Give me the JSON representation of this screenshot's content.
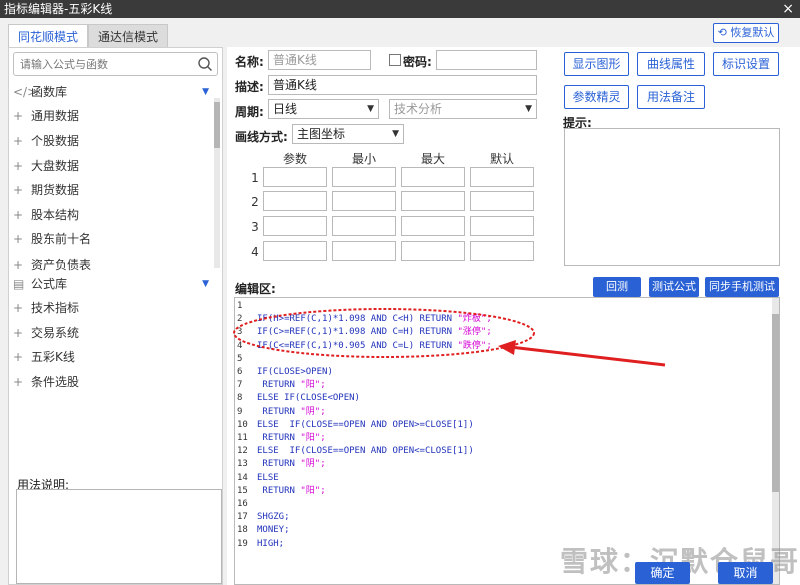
{
  "window": {
    "title": "指标编辑器-五彩K线",
    "close": "×"
  },
  "tabs": [
    {
      "label": "同花顺模式"
    },
    {
      "label": "通达信模式"
    }
  ],
  "restore_default": "恢复默认",
  "left": {
    "search_placeholder": "请输入公式与函数",
    "items": [
      {
        "icon": "</>",
        "label": "函数库"
      },
      {
        "icon": "+",
        "label": "通用数据"
      },
      {
        "icon": "+",
        "label": "个股数据"
      },
      {
        "icon": "+",
        "label": "大盘数据"
      },
      {
        "icon": "+",
        "label": "期货数据"
      },
      {
        "icon": "+",
        "label": "股本结构"
      },
      {
        "icon": "+",
        "label": "股东前十名"
      },
      {
        "icon": "+",
        "label": "资产负债表"
      },
      {
        "icon": "▤",
        "label": "公式库"
      },
      {
        "icon": "+",
        "label": "技术指标"
      },
      {
        "icon": "+",
        "label": "交易系统"
      },
      {
        "icon": "+",
        "label": "五彩K线"
      },
      {
        "icon": "+",
        "label": "条件选股"
      }
    ],
    "usage_label": "用法说明:"
  },
  "form": {
    "name_label": "名称:",
    "name_value": "普通K线",
    "password_label": "密码:",
    "desc_label": "描述:",
    "desc_value": "普通K线",
    "period_label": "周期:",
    "period_value": "日线",
    "category_value": "技术分析",
    "draw_label": "画线方式:",
    "draw_value": "主图坐标"
  },
  "buttons": {
    "show_figure": "显示图形",
    "curve_props": "曲线属性",
    "mark_settings": "标识设置",
    "param_wizard": "参数精灵",
    "usage_notes": "用法备注",
    "backtest": "回测",
    "test_formula": "测试公式",
    "sync_mobile": "同步手机测试",
    "ok": "确定",
    "cancel": "取消"
  },
  "hint_label": "提示:",
  "params": {
    "headers": [
      "参数",
      "最小",
      "最大",
      "默认"
    ],
    "rows": [
      "1",
      "2",
      "3",
      "4"
    ]
  },
  "editor": {
    "label": "编辑区:",
    "lines": [
      {
        "n": "1",
        "code": ""
      },
      {
        "n": "2",
        "code": "IF(H>=REF(C,1)*1.098 AND C<H) RETURN ",
        "str": "\"炸板\";"
      },
      {
        "n": "3",
        "code": "IF(C>=REF(C,1)*1.098 AND C=H) RETURN ",
        "str": "\"涨停\";"
      },
      {
        "n": "4",
        "code": "IF(C<=REF(C,1)*0.905 AND C=L) RETURN ",
        "str": "\"跌停\";"
      },
      {
        "n": "5",
        "code": ""
      },
      {
        "n": "6",
        "code": "IF(CLOSE>OPEN)"
      },
      {
        "n": "7",
        "code": " RETURN ",
        "str": "\"阳\";"
      },
      {
        "n": "8",
        "code": "ELSE IF(CLOSE<OPEN)"
      },
      {
        "n": "9",
        "code": " RETURN ",
        "str": "\"阴\";"
      },
      {
        "n": "10",
        "code": "ELSE  IF(CLOSE==OPEN AND OPEN>=CLOSE[1])"
      },
      {
        "n": "11",
        "code": " RETURN ",
        "str": "\"阳\";"
      },
      {
        "n": "12",
        "code": "ELSE  IF(CLOSE==OPEN AND OPEN<=CLOSE[1])"
      },
      {
        "n": "13",
        "code": " RETURN ",
        "str": "\"阴\";"
      },
      {
        "n": "14",
        "code": "ELSE"
      },
      {
        "n": "15",
        "code": " RETURN ",
        "str": "\"阳\";"
      },
      {
        "n": "16",
        "code": ""
      },
      {
        "n": "17",
        "code": "SHGZG;"
      },
      {
        "n": "18",
        "code": "MONEY;"
      },
      {
        "n": "19",
        "code": "HIGH;"
      }
    ]
  },
  "watermark": "雪球：沉默仓鼠哥",
  "colors": {
    "accent": "#2a62d6",
    "annotation": "#e02020"
  }
}
